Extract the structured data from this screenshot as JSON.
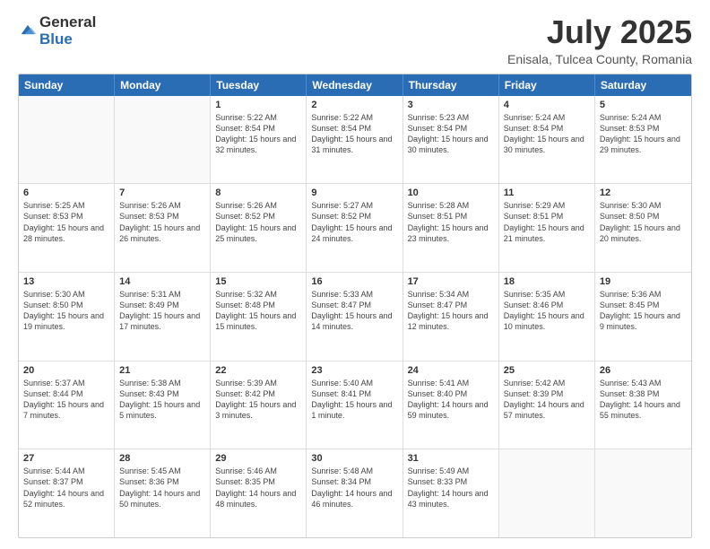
{
  "logo": {
    "general": "General",
    "blue": "Blue"
  },
  "title": {
    "month_year": "July 2025",
    "location": "Enisala, Tulcea County, Romania"
  },
  "header_days": [
    "Sunday",
    "Monday",
    "Tuesday",
    "Wednesday",
    "Thursday",
    "Friday",
    "Saturday"
  ],
  "weeks": [
    [
      {
        "day": "",
        "sunrise": "",
        "sunset": "",
        "daylight": ""
      },
      {
        "day": "",
        "sunrise": "",
        "sunset": "",
        "daylight": ""
      },
      {
        "day": "1",
        "sunrise": "Sunrise: 5:22 AM",
        "sunset": "Sunset: 8:54 PM",
        "daylight": "Daylight: 15 hours and 32 minutes."
      },
      {
        "day": "2",
        "sunrise": "Sunrise: 5:22 AM",
        "sunset": "Sunset: 8:54 PM",
        "daylight": "Daylight: 15 hours and 31 minutes."
      },
      {
        "day": "3",
        "sunrise": "Sunrise: 5:23 AM",
        "sunset": "Sunset: 8:54 PM",
        "daylight": "Daylight: 15 hours and 30 minutes."
      },
      {
        "day": "4",
        "sunrise": "Sunrise: 5:24 AM",
        "sunset": "Sunset: 8:54 PM",
        "daylight": "Daylight: 15 hours and 30 minutes."
      },
      {
        "day": "5",
        "sunrise": "Sunrise: 5:24 AM",
        "sunset": "Sunset: 8:53 PM",
        "daylight": "Daylight: 15 hours and 29 minutes."
      }
    ],
    [
      {
        "day": "6",
        "sunrise": "Sunrise: 5:25 AM",
        "sunset": "Sunset: 8:53 PM",
        "daylight": "Daylight: 15 hours and 28 minutes."
      },
      {
        "day": "7",
        "sunrise": "Sunrise: 5:26 AM",
        "sunset": "Sunset: 8:53 PM",
        "daylight": "Daylight: 15 hours and 26 minutes."
      },
      {
        "day": "8",
        "sunrise": "Sunrise: 5:26 AM",
        "sunset": "Sunset: 8:52 PM",
        "daylight": "Daylight: 15 hours and 25 minutes."
      },
      {
        "day": "9",
        "sunrise": "Sunrise: 5:27 AM",
        "sunset": "Sunset: 8:52 PM",
        "daylight": "Daylight: 15 hours and 24 minutes."
      },
      {
        "day": "10",
        "sunrise": "Sunrise: 5:28 AM",
        "sunset": "Sunset: 8:51 PM",
        "daylight": "Daylight: 15 hours and 23 minutes."
      },
      {
        "day": "11",
        "sunrise": "Sunrise: 5:29 AM",
        "sunset": "Sunset: 8:51 PM",
        "daylight": "Daylight: 15 hours and 21 minutes."
      },
      {
        "day": "12",
        "sunrise": "Sunrise: 5:30 AM",
        "sunset": "Sunset: 8:50 PM",
        "daylight": "Daylight: 15 hours and 20 minutes."
      }
    ],
    [
      {
        "day": "13",
        "sunrise": "Sunrise: 5:30 AM",
        "sunset": "Sunset: 8:50 PM",
        "daylight": "Daylight: 15 hours and 19 minutes."
      },
      {
        "day": "14",
        "sunrise": "Sunrise: 5:31 AM",
        "sunset": "Sunset: 8:49 PM",
        "daylight": "Daylight: 15 hours and 17 minutes."
      },
      {
        "day": "15",
        "sunrise": "Sunrise: 5:32 AM",
        "sunset": "Sunset: 8:48 PM",
        "daylight": "Daylight: 15 hours and 15 minutes."
      },
      {
        "day": "16",
        "sunrise": "Sunrise: 5:33 AM",
        "sunset": "Sunset: 8:47 PM",
        "daylight": "Daylight: 15 hours and 14 minutes."
      },
      {
        "day": "17",
        "sunrise": "Sunrise: 5:34 AM",
        "sunset": "Sunset: 8:47 PM",
        "daylight": "Daylight: 15 hours and 12 minutes."
      },
      {
        "day": "18",
        "sunrise": "Sunrise: 5:35 AM",
        "sunset": "Sunset: 8:46 PM",
        "daylight": "Daylight: 15 hours and 10 minutes."
      },
      {
        "day": "19",
        "sunrise": "Sunrise: 5:36 AM",
        "sunset": "Sunset: 8:45 PM",
        "daylight": "Daylight: 15 hours and 9 minutes."
      }
    ],
    [
      {
        "day": "20",
        "sunrise": "Sunrise: 5:37 AM",
        "sunset": "Sunset: 8:44 PM",
        "daylight": "Daylight: 15 hours and 7 minutes."
      },
      {
        "day": "21",
        "sunrise": "Sunrise: 5:38 AM",
        "sunset": "Sunset: 8:43 PM",
        "daylight": "Daylight: 15 hours and 5 minutes."
      },
      {
        "day": "22",
        "sunrise": "Sunrise: 5:39 AM",
        "sunset": "Sunset: 8:42 PM",
        "daylight": "Daylight: 15 hours and 3 minutes."
      },
      {
        "day": "23",
        "sunrise": "Sunrise: 5:40 AM",
        "sunset": "Sunset: 8:41 PM",
        "daylight": "Daylight: 15 hours and 1 minute."
      },
      {
        "day": "24",
        "sunrise": "Sunrise: 5:41 AM",
        "sunset": "Sunset: 8:40 PM",
        "daylight": "Daylight: 14 hours and 59 minutes."
      },
      {
        "day": "25",
        "sunrise": "Sunrise: 5:42 AM",
        "sunset": "Sunset: 8:39 PM",
        "daylight": "Daylight: 14 hours and 57 minutes."
      },
      {
        "day": "26",
        "sunrise": "Sunrise: 5:43 AM",
        "sunset": "Sunset: 8:38 PM",
        "daylight": "Daylight: 14 hours and 55 minutes."
      }
    ],
    [
      {
        "day": "27",
        "sunrise": "Sunrise: 5:44 AM",
        "sunset": "Sunset: 8:37 PM",
        "daylight": "Daylight: 14 hours and 52 minutes."
      },
      {
        "day": "28",
        "sunrise": "Sunrise: 5:45 AM",
        "sunset": "Sunset: 8:36 PM",
        "daylight": "Daylight: 14 hours and 50 minutes."
      },
      {
        "day": "29",
        "sunrise": "Sunrise: 5:46 AM",
        "sunset": "Sunset: 8:35 PM",
        "daylight": "Daylight: 14 hours and 48 minutes."
      },
      {
        "day": "30",
        "sunrise": "Sunrise: 5:48 AM",
        "sunset": "Sunset: 8:34 PM",
        "daylight": "Daylight: 14 hours and 46 minutes."
      },
      {
        "day": "31",
        "sunrise": "Sunrise: 5:49 AM",
        "sunset": "Sunset: 8:33 PM",
        "daylight": "Daylight: 14 hours and 43 minutes."
      },
      {
        "day": "",
        "sunrise": "",
        "sunset": "",
        "daylight": ""
      },
      {
        "day": "",
        "sunrise": "",
        "sunset": "",
        "daylight": ""
      }
    ]
  ]
}
